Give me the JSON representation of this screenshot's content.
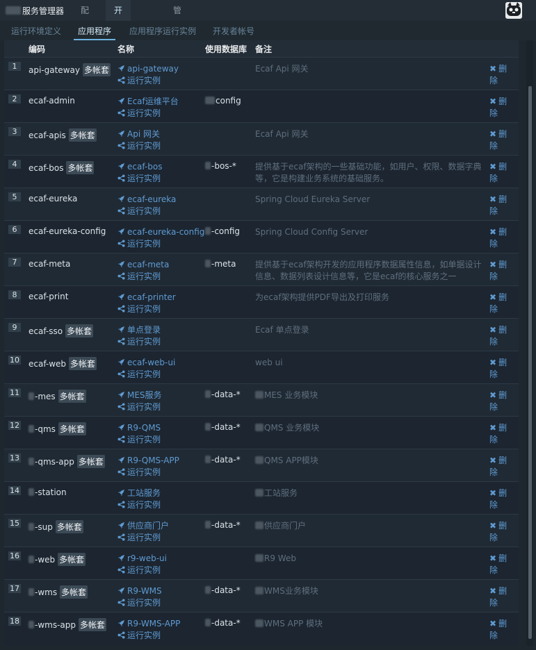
{
  "brand": {
    "title": "服务管理器"
  },
  "nav": {
    "items": [
      "配置",
      "开发者中心",
      "管理"
    ],
    "active": "开发者中心"
  },
  "subnav": {
    "items": [
      "运行环境定义",
      "应用程序",
      "应用程序运行实例",
      "开发者帐号"
    ],
    "active": "应用程序"
  },
  "table": {
    "headers": {
      "code": "编码",
      "name": "名称",
      "db": "使用数据库",
      "note": "备注"
    },
    "rows": [
      {
        "no": "1",
        "code": "api-gateway",
        "tag": "多帐套",
        "name": "api-gateway",
        "run": "运行实例",
        "db": "",
        "note": "Ecaf Api 网关",
        "del1": "删",
        "del2": "除"
      },
      {
        "no": "2",
        "code": "ecaf-admin",
        "tag": "",
        "name": "Ecaf运维平台",
        "run": "运行实例",
        "db": "config",
        "note": "",
        "del1": "删",
        "del2": "除"
      },
      {
        "no": "3",
        "code": "ecaf-apis",
        "tag": "多帐套",
        "name": "Api 网关",
        "run": "运行实例",
        "db": "",
        "note": "Ecaf Api 网关",
        "del1": "删",
        "del2": "除"
      },
      {
        "no": "4",
        "code": "ecaf-bos",
        "tag": "多帐套",
        "name": "ecaf-bos",
        "run": "运行实例",
        "db": "-bos-*",
        "note": "提供基于ecaf架构的一些基础功能，如用户、权限、数据字典等，它是构建业务系统的基础服务。",
        "del1": "删",
        "del2": "除"
      },
      {
        "no": "5",
        "code": "ecaf-eureka",
        "tag": "",
        "name": "ecaf-eureka",
        "run": "运行实例",
        "db": "",
        "note": "Spring Cloud Eureka Server",
        "del1": "删",
        "del2": "除"
      },
      {
        "no": "6",
        "code": "ecaf-eureka-config",
        "tag": "",
        "name": "ecaf-eureka-config",
        "run": "运行实例",
        "db": "-config",
        "note": "Spring Cloud Config Server",
        "del1": "删",
        "del2": "除"
      },
      {
        "no": "7",
        "code": "ecaf-meta",
        "tag": "",
        "name": "ecaf-meta",
        "run": "运行实例",
        "db": "-meta",
        "note": "提供基于ecaf架构开发的应用程序数据属性信息，如单据设计信息、数据列表设计信息等，它是ecaf的核心服务之一",
        "del1": "删",
        "del2": "除"
      },
      {
        "no": "8",
        "code": "ecaf-print",
        "tag": "",
        "name": "ecaf-printer",
        "run": "运行实例",
        "db": "",
        "note": "为ecaf架构提供PDF导出及打印服务",
        "del1": "删",
        "del2": "除"
      },
      {
        "no": "9",
        "code": "ecaf-sso",
        "tag": "多帐套",
        "name": "单点登录",
        "run": "运行实例",
        "db": "",
        "note": "Ecaf 单点登录",
        "del1": "删",
        "del2": "除"
      },
      {
        "no": "10",
        "code": "ecaf-web",
        "tag": "多帐套",
        "name": "ecaf-web-ui",
        "run": "运行实例",
        "db": "",
        "note": "web ui",
        "del1": "删",
        "del2": "除"
      },
      {
        "no": "11",
        "code": "-mes",
        "tag": "多帐套",
        "name": "MES服务",
        "run": "运行实例",
        "db": "-data-*",
        "note": "MES 业务模块",
        "del1": "删",
        "del2": "除"
      },
      {
        "no": "12",
        "code": "-qms",
        "tag": "多帐套",
        "name": "R9-QMS",
        "run": "运行实例",
        "db": "-data-*",
        "note": "QMS 业务模块",
        "del1": "删",
        "del2": "除"
      },
      {
        "no": "13",
        "code": "-qms-app",
        "tag": "多帐套",
        "name": "R9-QMS-APP",
        "run": "运行实例",
        "db": "-data-*",
        "note": "QMS APP模块",
        "del1": "删",
        "del2": "除"
      },
      {
        "no": "14",
        "code": "-station",
        "tag": "",
        "name": "工站服务",
        "run": "运行实例",
        "db": "",
        "note": "工站服务",
        "del1": "删",
        "del2": "除"
      },
      {
        "no": "15",
        "code": "-sup",
        "tag": "多帐套",
        "name": "供应商门户",
        "run": "运行实例",
        "db": "-data-*",
        "note": "供应商门户",
        "del1": "删",
        "del2": "除"
      },
      {
        "no": "16",
        "code": "-web",
        "tag": "多帐套",
        "name": "r9-web-ui",
        "run": "运行实例",
        "db": "",
        "note": "R9 Web",
        "del1": "删",
        "del2": "除"
      },
      {
        "no": "17",
        "code": "-wms",
        "tag": "多帐套",
        "name": "R9-WMS",
        "run": "运行实例",
        "db": "-data-*",
        "note": "WMS业务模块",
        "del1": "删",
        "del2": "除"
      },
      {
        "no": "18",
        "code": "-wms-app",
        "tag": "多帐套",
        "name": "R9-WMS-APP",
        "run": "运行实例",
        "db": "-data-*",
        "note": "WMS APP 模块",
        "del1": "删",
        "del2": "除"
      }
    ]
  }
}
